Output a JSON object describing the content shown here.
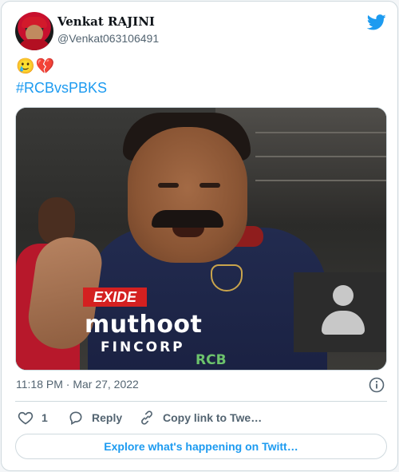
{
  "author": {
    "display_name": "Venkat RAJINI",
    "handle": "@Venkat063106491"
  },
  "tweet": {
    "emoji_line": "🥲💔",
    "hashtag": "#RCBvsPBKS"
  },
  "media": {
    "jersey": {
      "exide": "EXIDE",
      "muthoot": "muthoot",
      "fincorp": "FINCORP",
      "rcb": "RCB"
    }
  },
  "meta": {
    "timestamp": "11:18 PM · Mar 27, 2022"
  },
  "actions": {
    "like_count": "1",
    "reply_label": "Reply",
    "copy_label": "Copy link to Twe…"
  },
  "explore_label": "Explore what's happening on Twitt…",
  "colors": {
    "brand_blue": "#1d9bf0",
    "secondary_text": "#536471",
    "border": "#cfd9de"
  },
  "icons": [
    "twitter-bird-icon",
    "info-icon",
    "heart-icon",
    "reply-icon",
    "link-icon",
    "avatar-icon"
  ]
}
